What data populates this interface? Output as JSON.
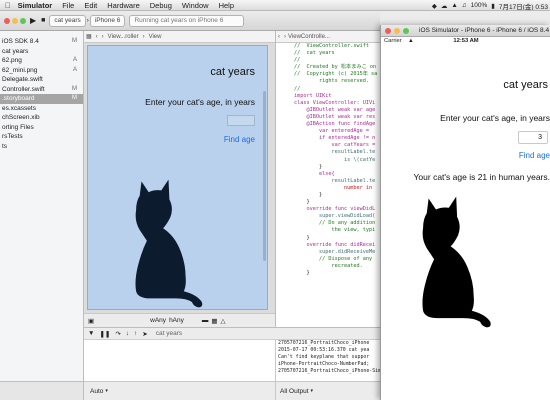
{
  "menubar": {
    "app_name": "Simulator",
    "items": [
      "File",
      "Edit",
      "Hardware",
      "Debug",
      "Window",
      "Help"
    ],
    "battery": "100%",
    "clock": "7月17日(金) 0:53"
  },
  "toolbar": {
    "scheme": "cat years",
    "device": "iPhone 6",
    "activity": "Running cat years on iPhone 6"
  },
  "navigator": {
    "rows": [
      {
        "label": "iOS SDK 8.4",
        "status": "M",
        "selected": false
      },
      {
        "label": "cat years",
        "status": "",
        "selected": false
      },
      {
        "label": "62.png",
        "status": "A",
        "selected": false
      },
      {
        "label": "62_mini.png",
        "status": "A",
        "selected": false
      },
      {
        "label": "Delegate.swift",
        "status": "",
        "selected": false
      },
      {
        "label": "Controller.swift",
        "status": "M",
        "selected": false
      },
      {
        "label": ".storyboard",
        "status": "M",
        "selected": true
      },
      {
        "label": "es.xcassets",
        "status": "",
        "selected": false
      },
      {
        "label": "chScreen.xib",
        "status": "",
        "selected": false
      },
      {
        "label": "orting Files",
        "status": "",
        "selected": false
      },
      {
        "label": "rsTests",
        "status": "",
        "selected": false
      },
      {
        "label": "ts",
        "status": "",
        "selected": false
      }
    ]
  },
  "ib": {
    "jump_items": [
      "View...roller",
      "View"
    ],
    "title": "cat years",
    "prompt": "Enter your cat's age, in years",
    "find_button": "Find age",
    "size_w": "wAny",
    "size_h": "hAny"
  },
  "code": {
    "jump_items": [
      "ViewControlle..."
    ],
    "lines": [
      {
        "type": "c",
        "text": "//  ViewController.swift"
      },
      {
        "type": "c",
        "text": "//  cat years"
      },
      {
        "type": "c",
        "text": "//"
      },
      {
        "type": "c",
        "text": "//  Created by 松本まみこ on"
      },
      {
        "type": "c",
        "text": "//  Copyright (c) 2015年 sa"
      },
      {
        "type": "c",
        "text": "        rights reserved."
      },
      {
        "type": "c",
        "text": "//"
      },
      {
        "type": "p",
        "text": ""
      },
      {
        "type": "k",
        "text": "import UIKit"
      },
      {
        "type": "p",
        "text": ""
      },
      {
        "type": "k",
        "text": "class ViewController: UIVi"
      },
      {
        "type": "p",
        "text": ""
      },
      {
        "type": "k",
        "text": "    @IBOutlet weak var age"
      },
      {
        "type": "p",
        "text": ""
      },
      {
        "type": "k",
        "text": "    @IBOutlet weak var res"
      },
      {
        "type": "p",
        "text": ""
      },
      {
        "type": "k",
        "text": "    @IBAction func findAge"
      },
      {
        "type": "p",
        "text": ""
      },
      {
        "type": "k",
        "text": "        var enteredAge = "
      },
      {
        "type": "p",
        "text": ""
      },
      {
        "type": "k",
        "text": "        if enteredAge != n"
      },
      {
        "type": "k",
        "text": "            var catYears ="
      },
      {
        "type": "t",
        "text": "            resultLabel.te"
      },
      {
        "type": "t",
        "text": "                is \\(catYe"
      },
      {
        "type": "p",
        "text": "        }"
      },
      {
        "type": "k",
        "text": "        else{"
      },
      {
        "type": "t",
        "text": "            resultLabel.te"
      },
      {
        "type": "s",
        "text": "                number in"
      },
      {
        "type": "p",
        "text": "        }"
      },
      {
        "type": "p",
        "text": ""
      },
      {
        "type": "p",
        "text": "    }"
      },
      {
        "type": "p",
        "text": ""
      },
      {
        "type": "k",
        "text": "    override func viewDidL"
      },
      {
        "type": "t",
        "text": "        super.viewDidLoad("
      },
      {
        "type": "c",
        "text": "        // Do any addition"
      },
      {
        "type": "c",
        "text": "            the view, typi"
      },
      {
        "type": "p",
        "text": "    }"
      },
      {
        "type": "p",
        "text": ""
      },
      {
        "type": "k",
        "text": "    override func didRecei"
      },
      {
        "type": "t",
        "text": "        super.didReceiveMe"
      },
      {
        "type": "c",
        "text": "        // Dispose of any"
      },
      {
        "type": "c",
        "text": "            recreated."
      },
      {
        "type": "p",
        "text": "    }"
      }
    ]
  },
  "debug": {
    "target": "cat years",
    "auto_label": "Auto",
    "output_label": "All Output",
    "console_lines": [
      "2705707216_PortraitChoco_iPhone",
      "2015-07-17 00:53:16.370 cat yea",
      "Can't find keyplane that suppor",
      "iPhone-PortraitChoco-NumberPad;",
      "2705707216_PortraitChoco_iPhone-Simple-Pad_Default"
    ]
  },
  "simulator": {
    "window_title": "iOS Simulator - iPhone 6 - iPhone 6 / iOS 8.4 (1",
    "carrier": "Carrier",
    "time": "12:53 AM",
    "title": "cat years",
    "prompt": "Enter your cat's age, in years",
    "age_value": "3",
    "find_button": "Find age",
    "result": "Your cat's age is 21 in human years."
  },
  "colors": {
    "ib_background": "#b9d1ec",
    "link_blue": "#1a6fe3",
    "ib_cat": "#0d1b2e",
    "sim_cat": "#000000",
    "selected_row": "#a5a5a5"
  }
}
